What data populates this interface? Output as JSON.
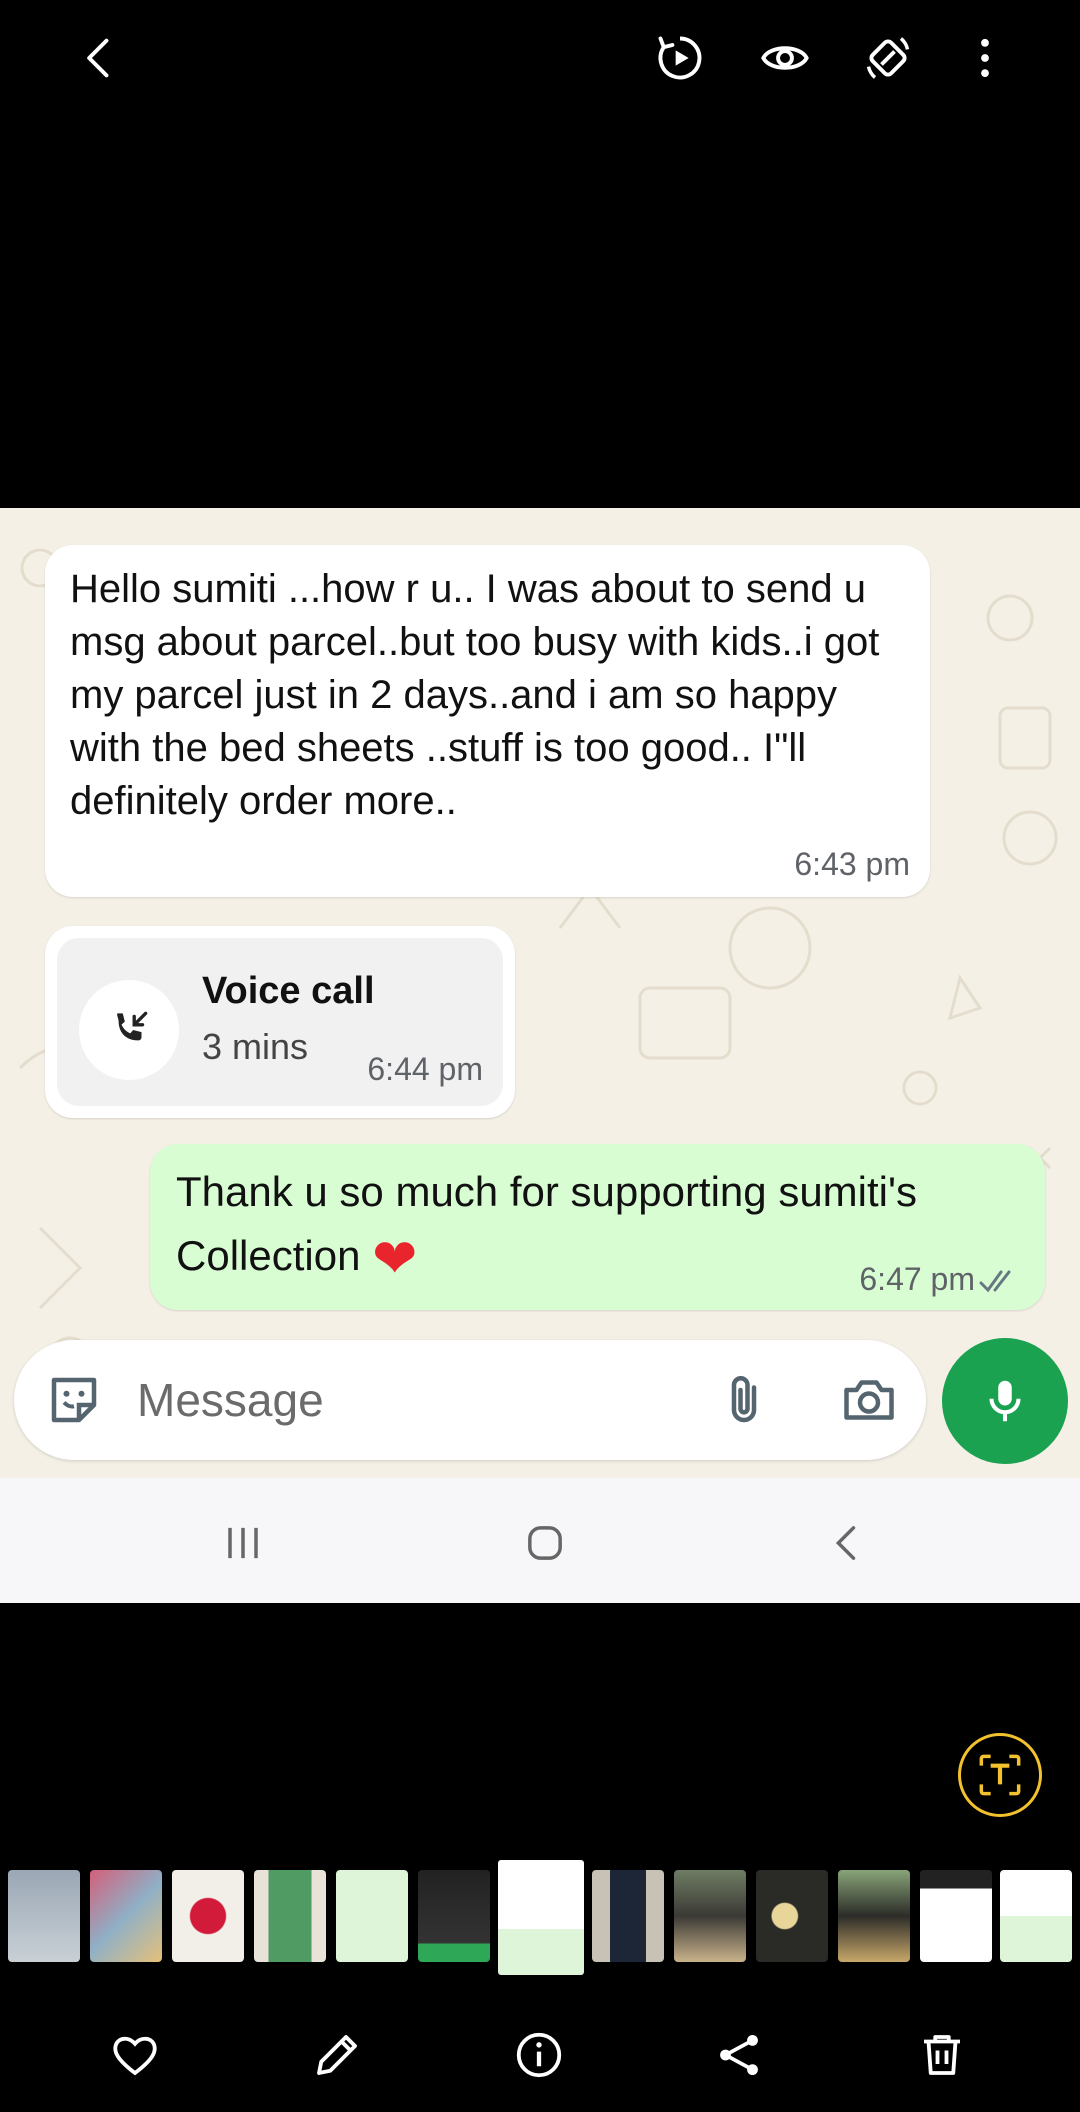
{
  "viewer": {
    "top_icons": [
      "back-arrow-icon",
      "play-motion-icon",
      "eye-icon",
      "auto-rotate-icon",
      "more-vert-icon"
    ],
    "bottom_icons": [
      "heart-icon",
      "pencil-icon",
      "info-icon",
      "share-icon",
      "trash-icon"
    ],
    "extract_text_icon": "text-extract-icon",
    "thumbnail_count": 13
  },
  "chat": {
    "messages": [
      {
        "direction": "incoming",
        "text": "Hello sumiti ...how r u.. I was about to send u msg about parcel..but too busy with kids..i got my parcel just in 2 days..and i am so happy with the bed sheets ..stuff is too good.. I\"ll definitely order more..",
        "time": "6:43 pm"
      },
      {
        "direction": "incoming",
        "type": "voice-call",
        "title": "Voice call",
        "duration": "3 mins",
        "time": "6:44 pm"
      },
      {
        "direction": "outgoing",
        "text": "Thank u so much for supporting sumiti's Collection",
        "emoji": "❤",
        "time": "6:47 pm",
        "status": "read"
      }
    ],
    "composer": {
      "placeholder": "Message"
    },
    "colors": {
      "outgoing_bubble": "#d9fdd3",
      "incoming_bubble": "#ffffff",
      "mic_button": "#1aa251",
      "wallpaper": "#f4f0e6"
    }
  }
}
